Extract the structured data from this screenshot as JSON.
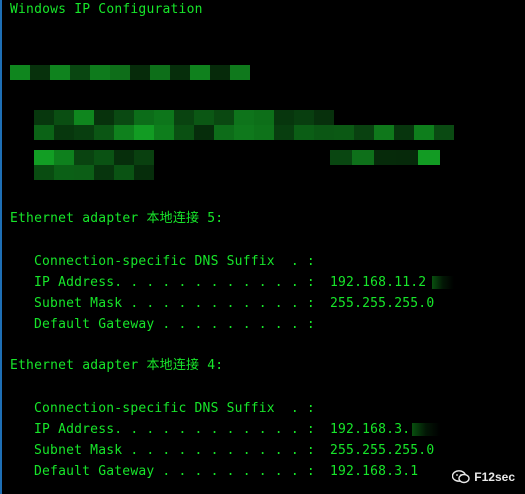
{
  "console": {
    "header": "Windows IP Configuration",
    "adapters": [
      {
        "title": "Ethernet adapter 本地连接 5:",
        "rows": [
          {
            "label": "Connection-specific DNS Suffix  . :",
            "value": ""
          },
          {
            "label": "IP Address. . . . . . . . . . . . :",
            "value": "192.168.11.2"
          },
          {
            "label": "Subnet Mask . . . . . . . . . . . :",
            "value": "255.255.255.0"
          },
          {
            "label": "Default Gateway . . . . . . . . . :",
            "value": ""
          }
        ]
      },
      {
        "title": "Ethernet adapter 本地连接 4:",
        "rows": [
          {
            "label": "Connection-specific DNS Suffix  . :",
            "value": ""
          },
          {
            "label": "IP Address. . . . . . . . . . . . :",
            "value": "192.168.3."
          },
          {
            "label": "Subnet Mask . . . . . . . . . . . :",
            "value": "255.255.255.0"
          },
          {
            "label": "Default Gateway . . . . . . . . . :",
            "value": "192.168.3.1"
          }
        ]
      }
    ],
    "colors": {
      "text": "#17e62a",
      "background": "#000000",
      "redaction_dark": "#0a4a12",
      "redaction_mid": "#0f7a1c",
      "redaction_light": "#13a826"
    }
  },
  "watermark": {
    "icon": "wechat-icon",
    "text": "F12sec"
  }
}
